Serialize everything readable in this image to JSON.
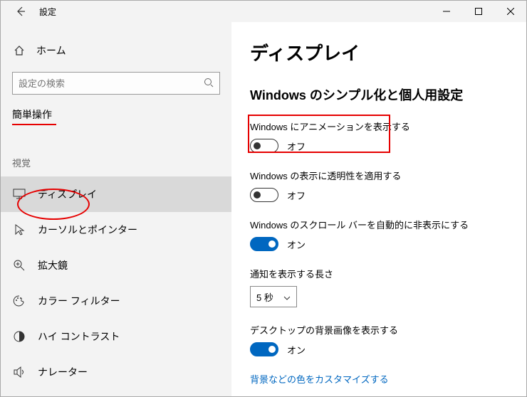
{
  "titlebar": {
    "title": "設定"
  },
  "sidebar": {
    "home": "ホーム",
    "search_placeholder": "設定の検索",
    "category": "簡単操作",
    "vision_header": "視覚",
    "items": [
      {
        "label": "ディスプレイ"
      },
      {
        "label": "カーソルとポインター"
      },
      {
        "label": "拡大鏡"
      },
      {
        "label": "カラー フィルター"
      },
      {
        "label": "ハイ コントラスト"
      },
      {
        "label": "ナレーター"
      }
    ]
  },
  "content": {
    "h1": "ディスプレイ",
    "h2": "Windows のシンプル化と個人用設定",
    "settings": [
      {
        "label": "Windows にアニメーションを表示する",
        "on": false,
        "state": "オフ"
      },
      {
        "label": "Windows の表示に透明性を適用する",
        "on": false,
        "state": "オフ"
      },
      {
        "label": "Windows のスクロール バーを自動的に非表示にする",
        "on": true,
        "state": "オン"
      }
    ],
    "duration_label": "通知を表示する長さ",
    "duration_value": "5 秒",
    "bg_setting": {
      "label": "デスクトップの背景画像を表示する",
      "on": true,
      "state": "オン"
    },
    "link": "背景などの色をカスタマイズする"
  }
}
